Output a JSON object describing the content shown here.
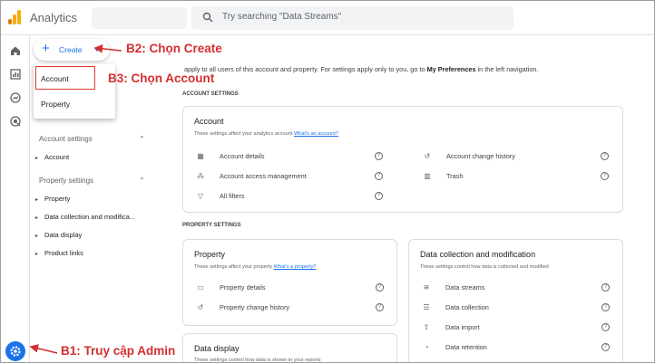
{
  "app": {
    "title": "Analytics",
    "search_placeholder": "Try searching \"Data Streams\""
  },
  "rail_icons": [
    "home-icon",
    "reports-icon",
    "explore-icon",
    "advertising-icon"
  ],
  "create_button": {
    "label": "Create"
  },
  "create_menu": {
    "items": [
      "Account",
      "Property"
    ]
  },
  "nav": {
    "account_settings": {
      "label": "Account settings",
      "items": [
        "Account"
      ]
    },
    "property_settings": {
      "label": "Property settings",
      "items": [
        "Property",
        "Data collection and modifica...",
        "Data display",
        "Product links"
      ]
    }
  },
  "intro": {
    "text_before": "apply to all users of this account and property. For settings apply only to you, go to ",
    "bold": "My Preferences",
    "text_after": " in the left navigation."
  },
  "sections": {
    "account": "ACCOUNT SETTINGS",
    "property": "PROPERTY SETTINGS"
  },
  "account_card": {
    "title": "Account",
    "desc": "These settings affect your analytics account ",
    "link": "What's an account?",
    "left_rows": [
      {
        "icon": "building-icon",
        "label": "Account details"
      },
      {
        "icon": "people-icon",
        "label": "Account access management"
      },
      {
        "icon": "filter-icon",
        "label": "All filters"
      }
    ],
    "right_rows": [
      {
        "icon": "history-icon",
        "label": "Account change history"
      },
      {
        "icon": "trash-icon",
        "label": "Trash"
      }
    ]
  },
  "property_card": {
    "title": "Property",
    "desc": "These settings affect your property ",
    "link": "What's a property?",
    "rows": [
      {
        "icon": "card-icon",
        "label": "Property details"
      },
      {
        "icon": "history-icon",
        "label": "Property change history"
      }
    ]
  },
  "data_collection_card": {
    "title": "Data collection and modification",
    "desc": "These settings control how data is collected and modified",
    "rows": [
      {
        "icon": "streams-icon",
        "label": "Data streams"
      },
      {
        "icon": "database-icon",
        "label": "Data collection"
      },
      {
        "icon": "upload-icon",
        "label": "Data import"
      },
      {
        "icon": "retention-icon",
        "label": "Data retention"
      }
    ]
  },
  "data_display_card": {
    "title": "Data display",
    "desc": "These settings control how data is shown in your reports"
  },
  "annotations": {
    "b1": "B1: Truy cập Admin",
    "b2": "B2: Chọn Create",
    "b3": "B3: Chọn Account"
  },
  "colors": {
    "accent": "#1a73e8",
    "annotation": "#d32f2f",
    "logo": [
      "#f9ab00",
      "#e37400"
    ]
  }
}
